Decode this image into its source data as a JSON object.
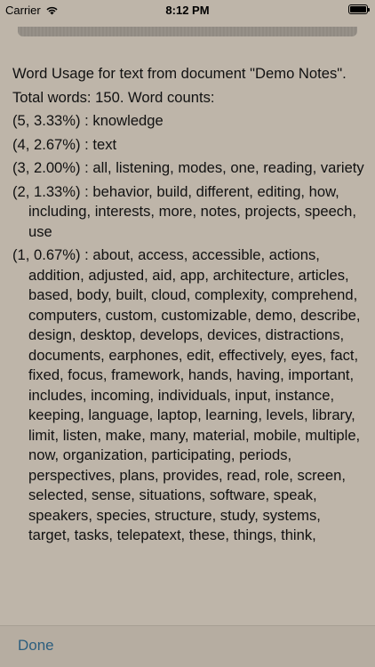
{
  "status_bar": {
    "carrier": "Carrier",
    "time": "8:12 PM"
  },
  "report": {
    "heading": "Word Usage for text from document \"Demo Notes\".",
    "summary": "Total words: 150. Word counts:",
    "entries": [
      {
        "count": "(5, 3.33%)",
        "separator": " : ",
        "words": "knowledge"
      },
      {
        "count": "(4, 2.67%)",
        "separator": " : ",
        "words": "text"
      },
      {
        "count": "(3, 2.00%)",
        "separator": " : ",
        "words": "all, listening, modes, one, reading, variety"
      },
      {
        "count": "(2, 1.33%)",
        "separator": " : ",
        "words": "behavior, build, different, editing, how, including, interests, more, notes, projects, speech, use"
      },
      {
        "count": "(1, 0.67%)",
        "separator": " : ",
        "words": "about, access, accessible, actions, addition, adjusted, aid, app, architecture, articles, based, body, built, cloud, complexity, comprehend, computers, custom, customizable, demo, describe, design, desktop, develops, devices, distractions, documents, earphones, edit, effectively, eyes, fact, fixed, focus, framework, hands, having, important, includes, incoming, individuals, input, instance, keeping, language, laptop, learning, levels, library, limit, listen, make, many, material, mobile, multiple, now, organization, participating, periods, perspectives, plans, provides, read, role, screen, selected, sense, situations, software, speak, speakers, species, structure, study, systems, target, tasks, telepatext, these, things, think,"
      }
    ]
  },
  "toolbar": {
    "done_label": "Done"
  }
}
